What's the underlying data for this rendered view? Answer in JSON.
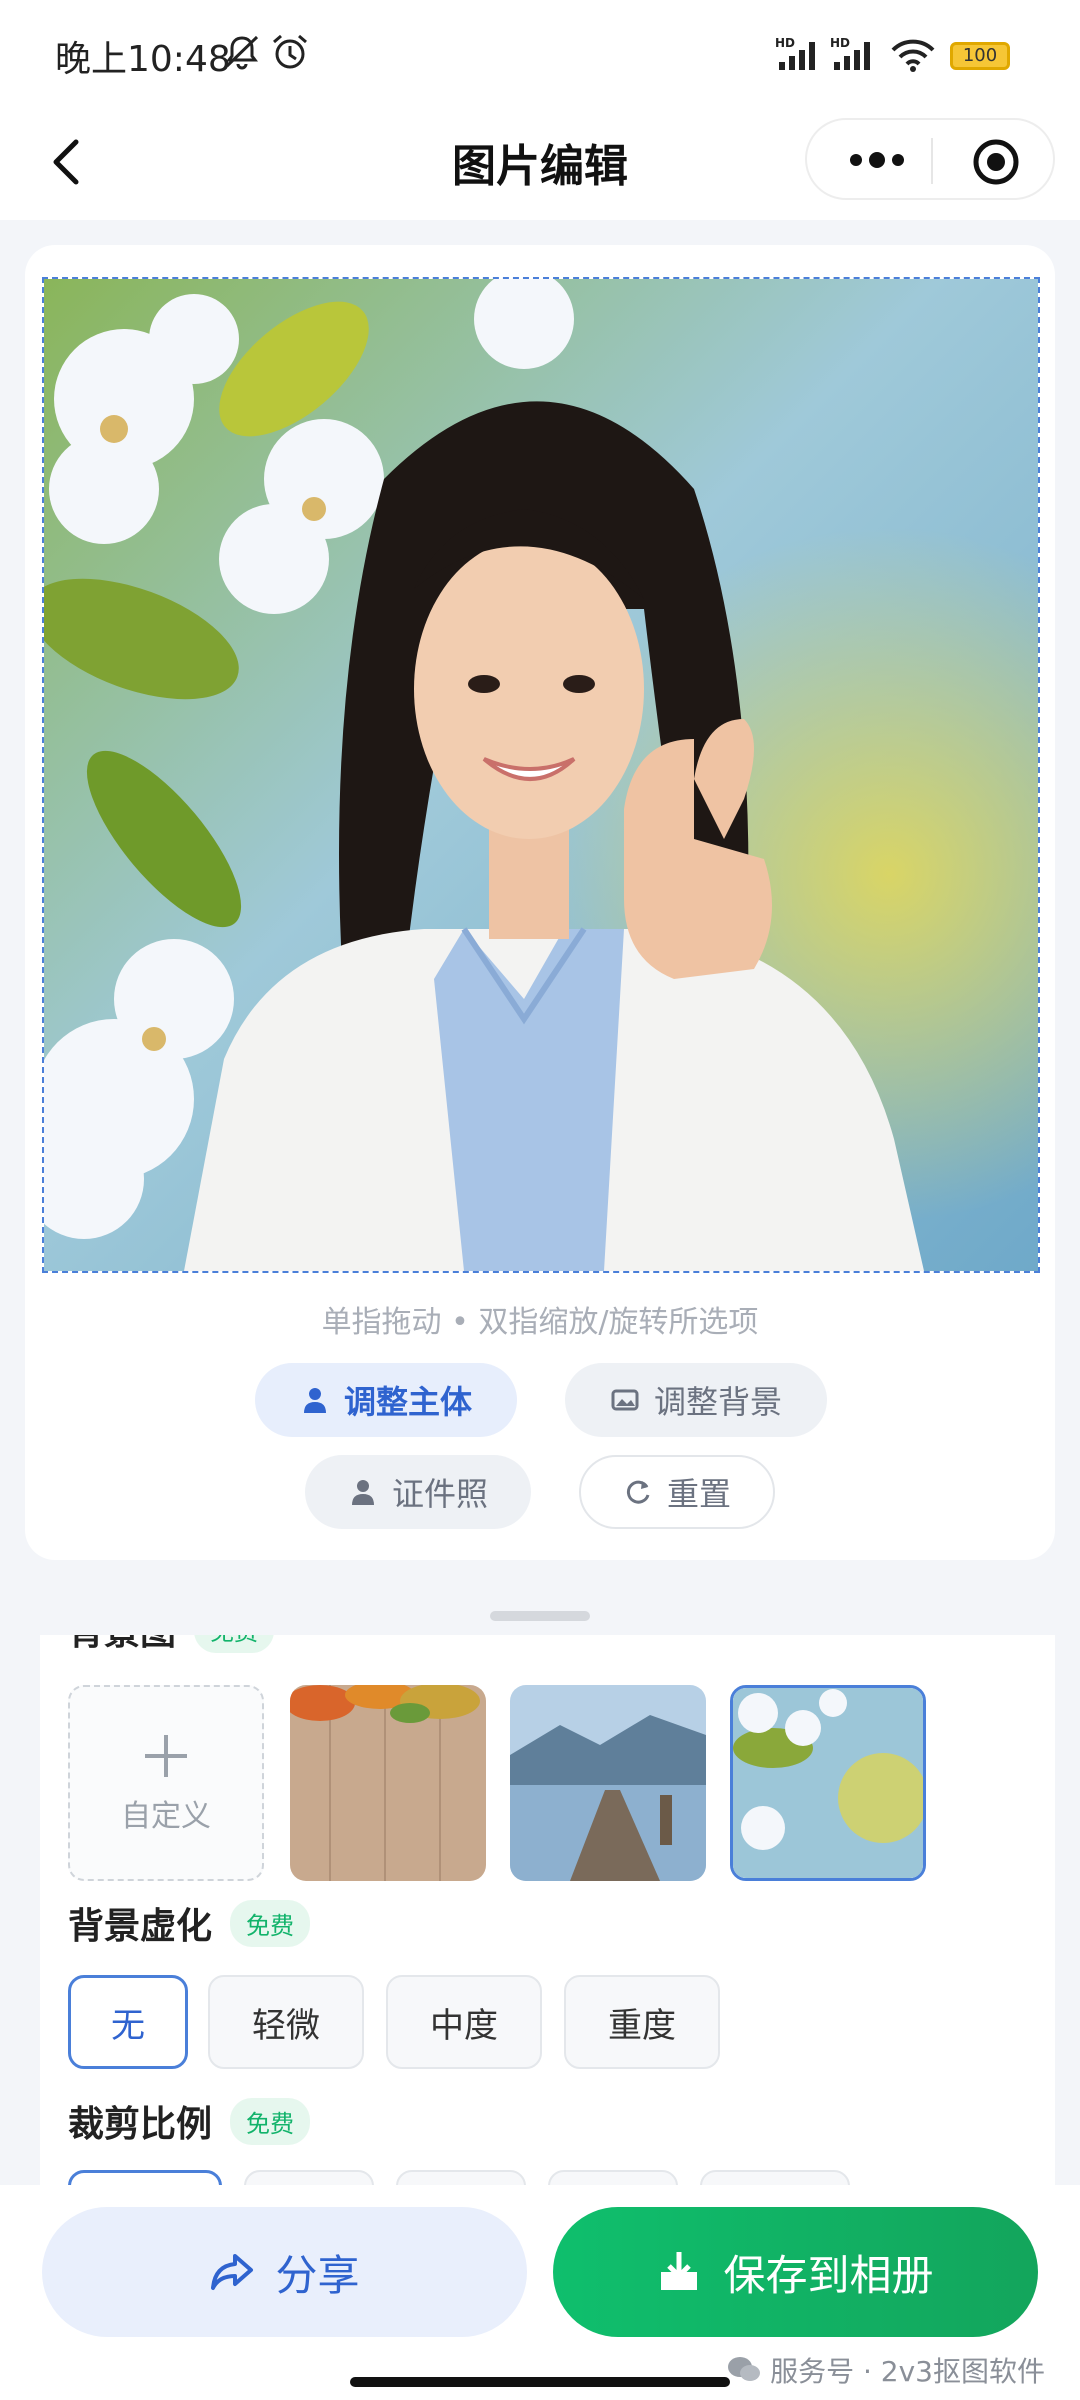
{
  "status_bar": {
    "time": "晚上10:48",
    "battery": "100",
    "signal_1_label": "HD",
    "signal_2_label": "HD"
  },
  "nav": {
    "title": "图片编辑"
  },
  "editor": {
    "hint": "单指拖动 • 双指缩放/旋转所选项",
    "buttons": {
      "adjust_subject": "调整主体",
      "adjust_background": "调整背景",
      "id_photo": "证件照",
      "reset": "重置"
    }
  },
  "panel": {
    "background_section": {
      "title": "背景图",
      "badge": "免费",
      "custom_label": "自定义",
      "selected_index": 3
    },
    "blur_section": {
      "title": "背景虚化",
      "badge": "免费",
      "options": [
        "无",
        "轻微",
        "中度",
        "重度"
      ],
      "selected": "无"
    },
    "crop_section": {
      "title": "裁剪比例",
      "badge": "免费"
    }
  },
  "actions": {
    "share": "分享",
    "save": "保存到相册"
  },
  "watermark": "服务号 · 2v3抠图软件",
  "colors": {
    "accent_blue": "#2f63cf",
    "save_green": "#0fbf6d",
    "free_green": "#12b36b"
  }
}
